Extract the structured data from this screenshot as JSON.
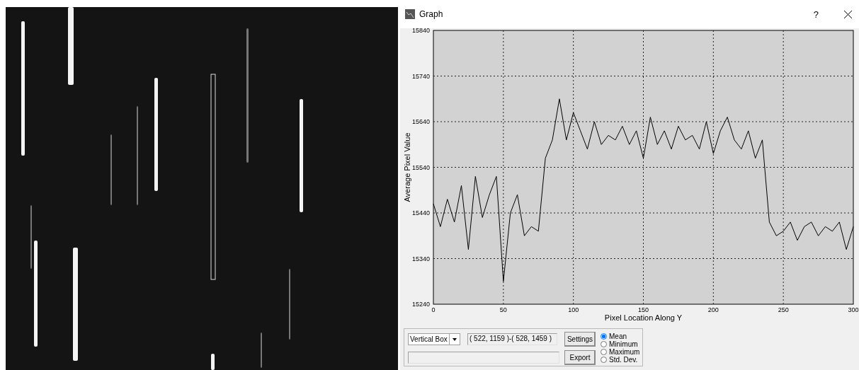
{
  "window": {
    "title": "Graph",
    "help": "?"
  },
  "chart": {
    "chart_data": {
      "type": "line",
      "xlabel": "Pixel Location Along Y",
      "ylabel": "Average Pixel Value",
      "grid": true,
      "xlim": [
        0,
        300
      ],
      "ylim": [
        15240,
        15840
      ],
      "xticks": [
        0,
        50,
        100,
        150,
        200,
        250,
        300
      ],
      "yticks": [
        15240,
        15340,
        15440,
        15540,
        15640,
        15740,
        15840
      ],
      "x": [
        0,
        5,
        10,
        15,
        20,
        25,
        30,
        35,
        40,
        45,
        50,
        55,
        60,
        65,
        70,
        75,
        80,
        85,
        90,
        95,
        100,
        105,
        110,
        115,
        120,
        125,
        130,
        135,
        140,
        145,
        150,
        155,
        160,
        165,
        170,
        175,
        180,
        185,
        190,
        195,
        200,
        205,
        210,
        215,
        220,
        225,
        230,
        235,
        240,
        245,
        250,
        255,
        260,
        265,
        270,
        275,
        280,
        285,
        290,
        295,
        300
      ],
      "series": [
        {
          "color": "#000000",
          "values": [
            15460,
            15410,
            15470,
            15420,
            15500,
            15360,
            15520,
            15430,
            15480,
            15520,
            15290,
            15440,
            15480,
            15390,
            15410,
            15400,
            15560,
            15600,
            15690,
            15600,
            15660,
            15620,
            15580,
            15640,
            15590,
            15610,
            15600,
            15630,
            15590,
            15620,
            15560,
            15650,
            15590,
            15620,
            15580,
            15630,
            15600,
            15610,
            15580,
            15640,
            15570,
            15620,
            15650,
            15600,
            15580,
            15620,
            15560,
            15600,
            15420,
            15390,
            15400,
            15420,
            15380,
            15410,
            15420,
            15390,
            15410,
            15400,
            15420,
            15360,
            15410
          ]
        }
      ]
    }
  },
  "controls": {
    "mode": {
      "value": "Vertical Box"
    },
    "coordinates": {
      "value": "( 522, 1159 )-( 528, 1459 )"
    },
    "buttons": [
      "Settings",
      "Export"
    ],
    "statistics": [
      {
        "label": "Mean",
        "selected": true
      },
      {
        "label": "Minimum",
        "selected": false
      },
      {
        "label": "Maximum",
        "selected": false
      },
      {
        "label": "Std. Dev.",
        "selected": false
      }
    ]
  }
}
